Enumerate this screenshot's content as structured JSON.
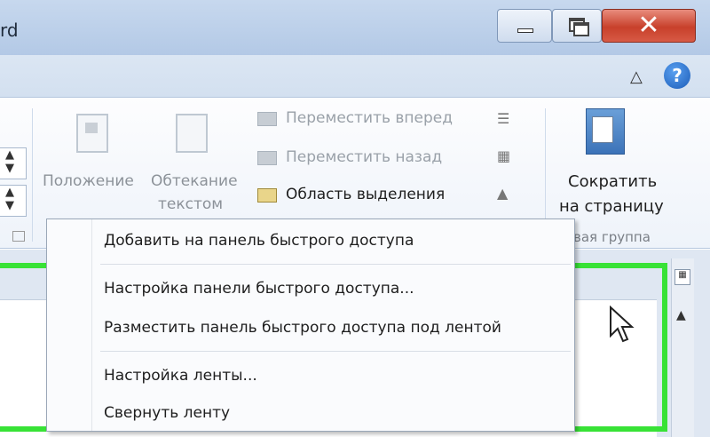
{
  "window": {
    "title_fragment": "rd",
    "close_label": "✕"
  },
  "help": {
    "label": "?"
  },
  "ribbon": {
    "arrange": {
      "position_label": "Положение",
      "wrap_label_1": "Обтекание",
      "wrap_label_2": "текстом",
      "bring_forward": "Переместить вперед",
      "send_backward": "Переместить назад",
      "selection_pane": "Область выделения"
    },
    "fit": {
      "label_1": "Сократить",
      "label_2": "на страницу",
      "group_name": "вая группа"
    }
  },
  "context_menu": {
    "items": [
      "Добавить на панель быстрого доступа",
      "Настройка панели быстрого доступа...",
      "Разместить панель быстрого доступа под лентой",
      "Настройка ленты...",
      "Свернуть ленту"
    ]
  },
  "colors": {
    "highlight": "#38e236",
    "close_button": "#c8402b",
    "titlebar": "#c7d8ee"
  }
}
